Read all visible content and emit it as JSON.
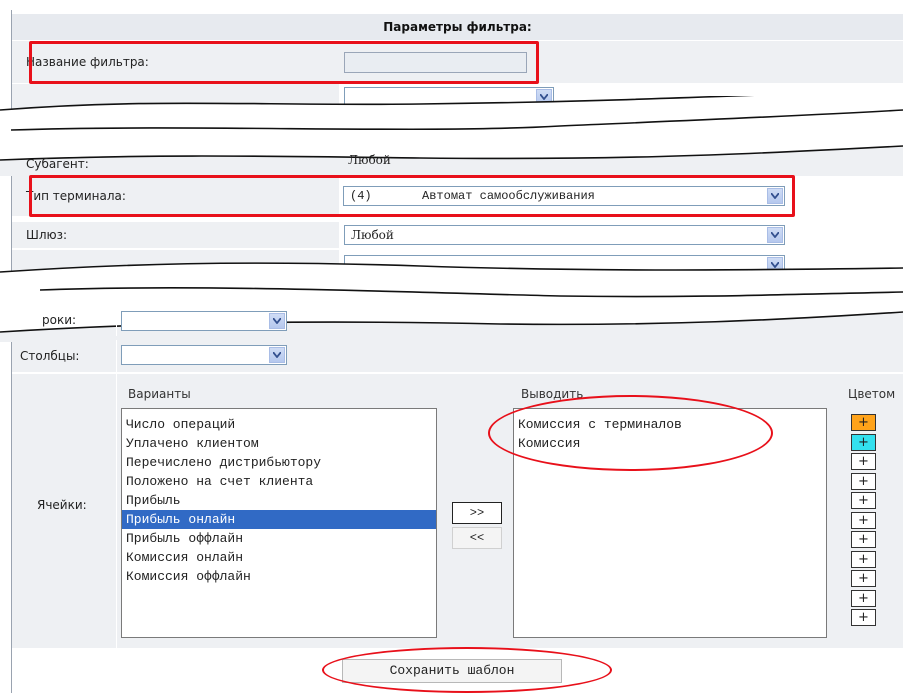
{
  "filter": {
    "header": "Параметры фильтра:",
    "name_label": "Название фильтра:",
    "name_value": "",
    "subagent_label": "Субагент:",
    "subagent_value": "Любой",
    "terminal_type_label": "Тип терминала:",
    "terminal_type_value": "(4)       Автомат самообслуживания",
    "gateway_label": "Шлюз:",
    "gateway_value": "Любой",
    "rows_label_partial": "роки:",
    "columns_label": "Столбцы:",
    "cells_label": "Ячейки:"
  },
  "cells": {
    "variants_header": "Варианты",
    "output_header": "Выводить",
    "color_header": "Цветом",
    "variants": [
      "Число операций",
      "Уплачено клиентом",
      "Перечислено дистрибьютору",
      "Положено на счет клиента",
      "Прибыль",
      "Прибыль онлайн",
      "Прибыль оффлайн",
      "Комиссия онлайн",
      "Комиссия оффлайн"
    ],
    "selected_variant": "Прибыль онлайн",
    "output": [
      "Комиссия с терминалов",
      "Комиссия"
    ],
    "move_right": ">>",
    "move_left": "<<",
    "color_buttons": [
      "+",
      "+",
      "+",
      "+",
      "+",
      "+",
      "+",
      "+",
      "+",
      "+",
      "+"
    ],
    "color_values": [
      "#ffa31a",
      "#33e0ee",
      "#ffffff",
      "#ffffff",
      "#ffffff",
      "#ffffff",
      "#ffffff",
      "#ffffff",
      "#ffffff",
      "#ffffff",
      "#ffffff"
    ]
  },
  "actions": {
    "save_template": "Сохранить шаблон"
  },
  "annotations": {
    "highlight_color": "#e8101a"
  }
}
